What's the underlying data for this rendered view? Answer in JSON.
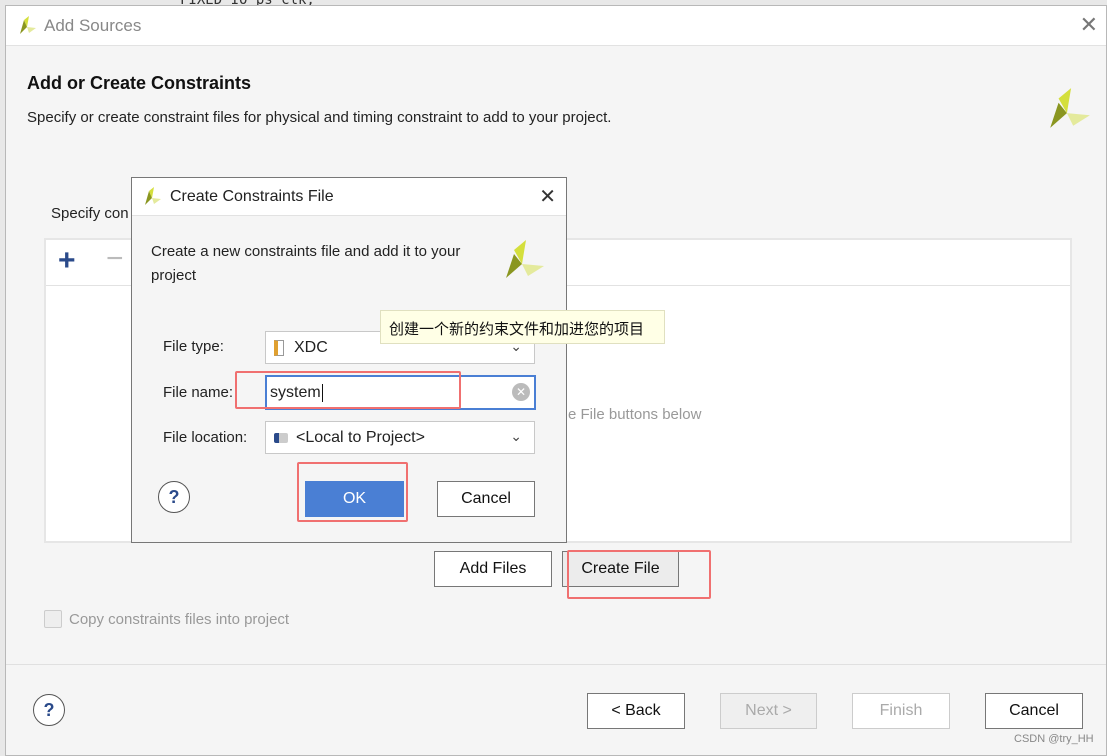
{
  "background_code": "FIXED_IO_ps_clk,",
  "main_dialog": {
    "title": "Add Sources",
    "heading": "Add or Create Constraints",
    "description": "Specify or create constraint files for physical and timing constraint to add to your project.",
    "specify_label": "Specify con",
    "empty_hint": "e File buttons below",
    "add_files": "Add Files",
    "create_file": "Create File",
    "copy_checkbox": "Copy constraints files into project",
    "copy_checked": false,
    "back": "< Back",
    "next": "Next >",
    "finish": "Finish",
    "cancel": "Cancel"
  },
  "sub_dialog": {
    "title": "Create Constraints File",
    "description": "Create a new constraints file and add it to your project",
    "file_type_label": "File type:",
    "file_type_value": "XDC",
    "file_name_label": "File name:",
    "file_name_value": "system",
    "file_location_label": "File location:",
    "file_location_value": "<Local to Project>",
    "ok": "OK",
    "cancel": "Cancel"
  },
  "tooltip": "创建一个新的约束文件和加进您的项目",
  "watermark": "CSDN @try_HH",
  "colors": {
    "accent": "#4a7fd4",
    "highlight": "#f07070",
    "logo_light": "#d4df3c",
    "logo_dark": "#8a9620"
  }
}
